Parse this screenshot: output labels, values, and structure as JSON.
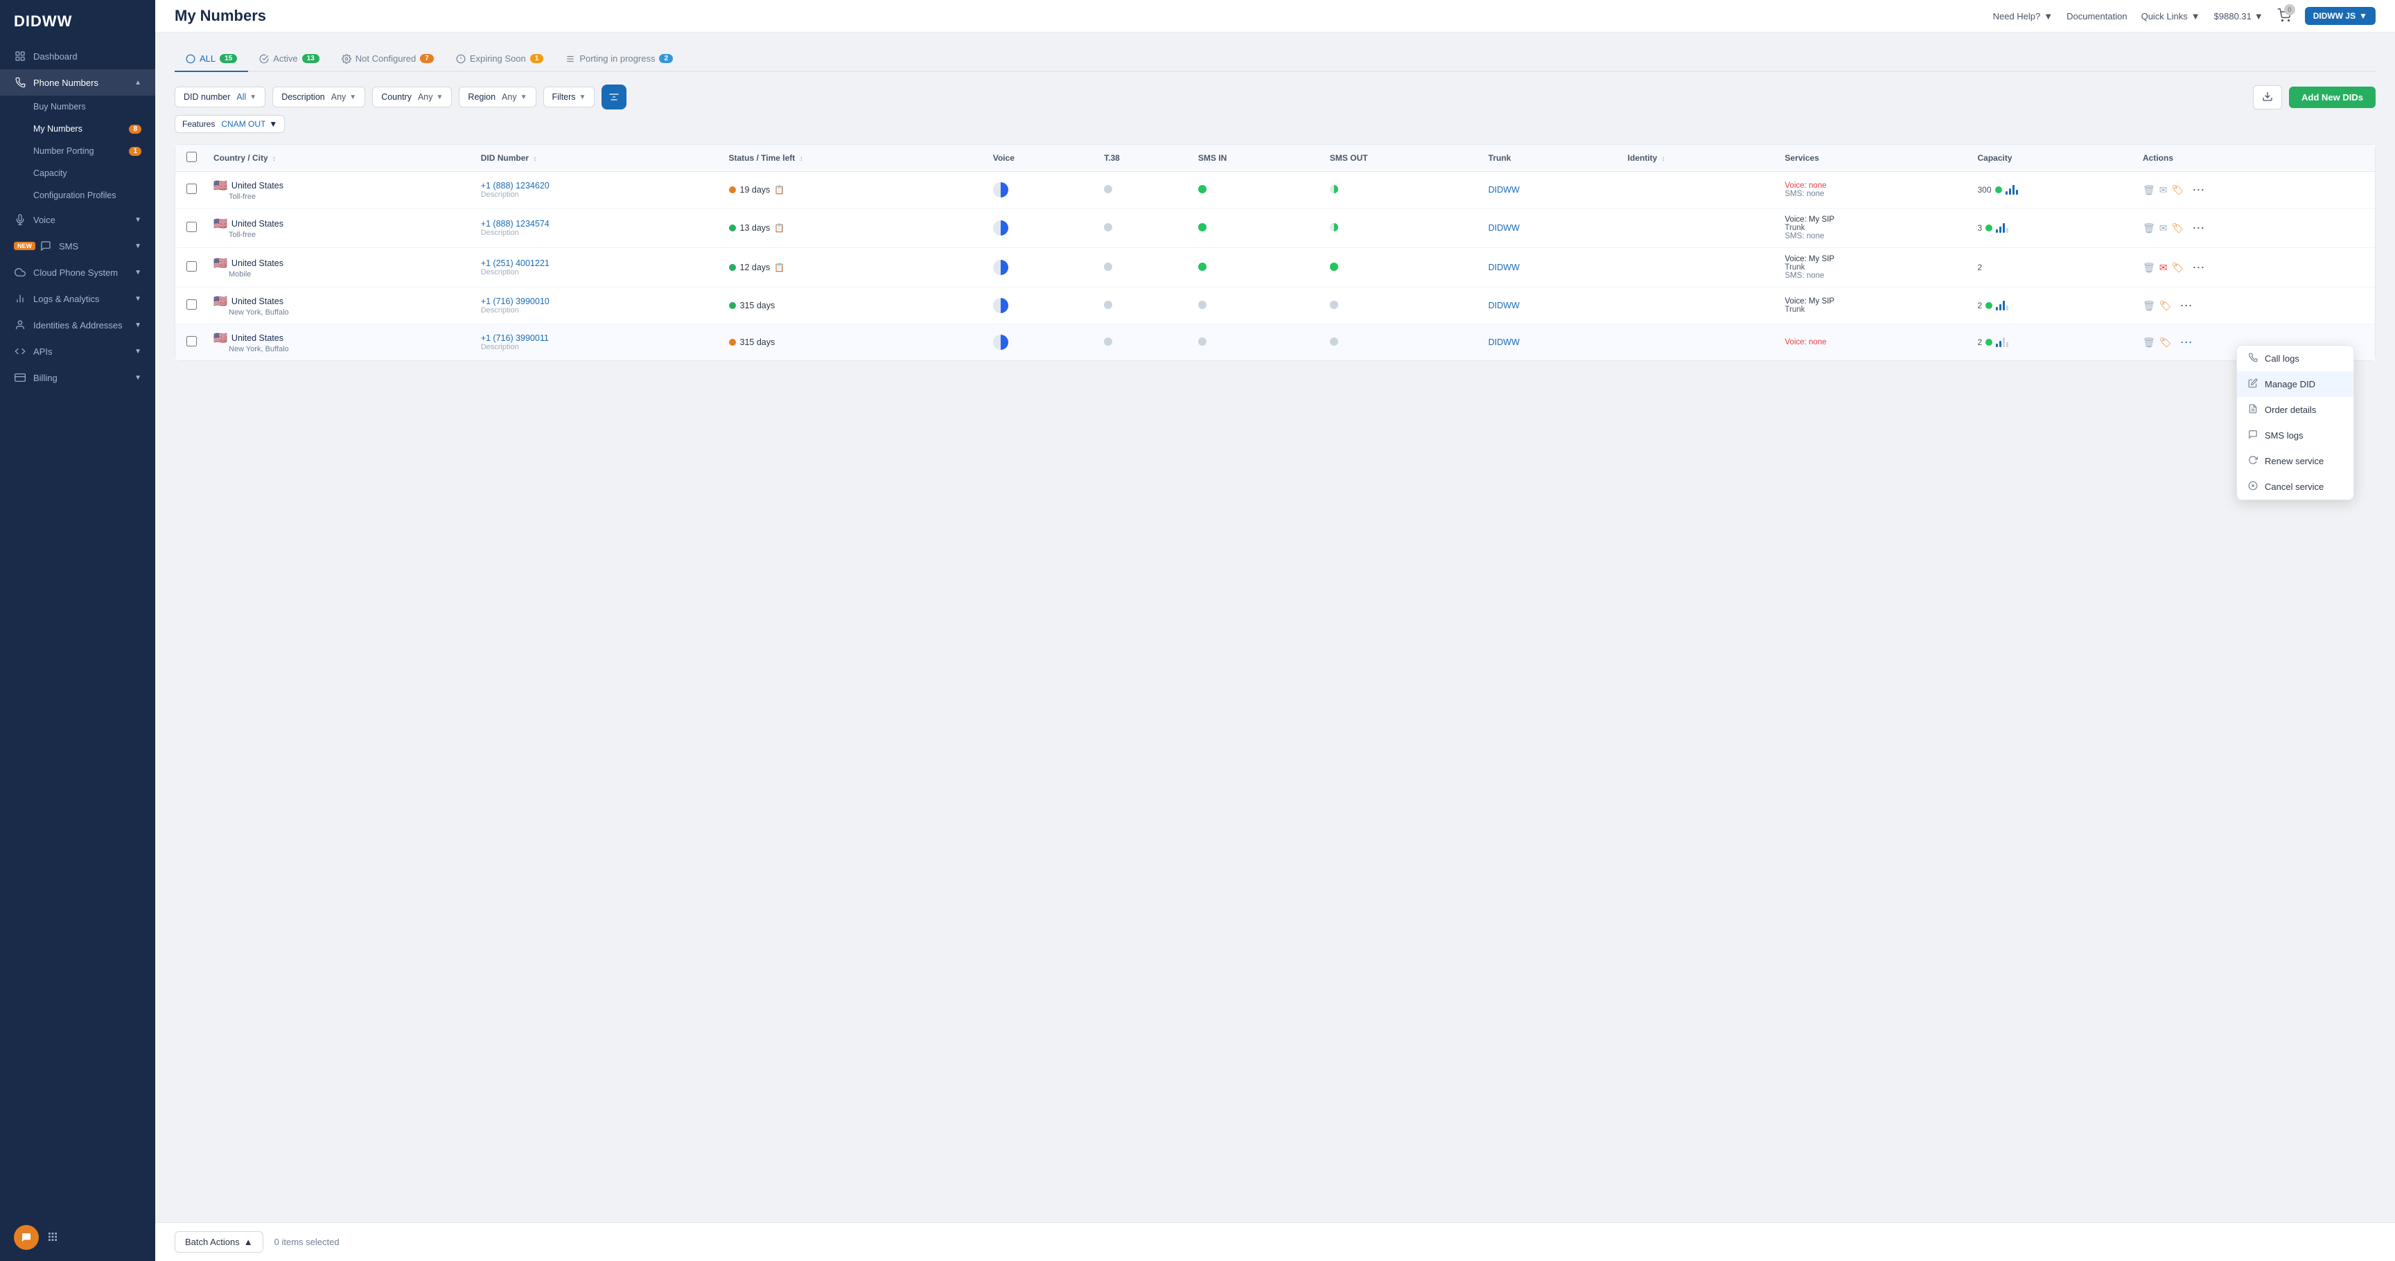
{
  "sidebar": {
    "logo": "DIDWW",
    "nav": [
      {
        "id": "dashboard",
        "label": "Dashboard",
        "icon": "grid",
        "active": false,
        "badge": null
      },
      {
        "id": "phone-numbers",
        "label": "Phone Numbers",
        "icon": "phone",
        "active": true,
        "expanded": true,
        "badge": null
      },
      {
        "id": "buy-numbers",
        "label": "Buy Numbers",
        "sub": true,
        "active": false,
        "badge": null
      },
      {
        "id": "my-numbers",
        "label": "My Numbers",
        "sub": true,
        "active": true,
        "badge": "8"
      },
      {
        "id": "number-porting",
        "label": "Number Porting",
        "sub": true,
        "active": false,
        "badge": "1"
      },
      {
        "id": "capacity",
        "label": "Capacity",
        "sub": true,
        "active": false,
        "badge": null
      },
      {
        "id": "configuration-profiles",
        "label": "Configuration Profiles",
        "sub": true,
        "active": false,
        "badge": null
      },
      {
        "id": "voice",
        "label": "Voice",
        "icon": "mic",
        "active": false,
        "badge": null
      },
      {
        "id": "sms",
        "label": "SMS",
        "icon": "message",
        "active": false,
        "badge": null,
        "new": true
      },
      {
        "id": "cloud-phone",
        "label": "Cloud Phone System",
        "icon": "cloud",
        "active": false,
        "badge": null
      },
      {
        "id": "logs",
        "label": "Logs & Analytics",
        "icon": "bar-chart",
        "active": false,
        "badge": null
      },
      {
        "id": "identities",
        "label": "Identities & Addresses",
        "icon": "user",
        "active": false,
        "badge": null
      },
      {
        "id": "apis",
        "label": "APIs",
        "icon": "code",
        "active": false,
        "badge": null
      },
      {
        "id": "billing",
        "label": "Billing",
        "icon": "credit-card",
        "active": false,
        "badge": null
      }
    ]
  },
  "header": {
    "title": "My Numbers",
    "needHelp": "Need Help?",
    "documentation": "Documentation",
    "quickLinks": "Quick Links",
    "balance": "$9880.31",
    "cartCount": "0",
    "userLabel": "DIDWW JS"
  },
  "tabs": [
    {
      "id": "all",
      "label": "ALL",
      "count": "15",
      "badge_class": "green",
      "active": true
    },
    {
      "id": "active",
      "label": "Active",
      "count": "13",
      "badge_class": "green",
      "active": false
    },
    {
      "id": "not-configured",
      "label": "Not Configured",
      "count": "7",
      "badge_class": "orange",
      "active": false
    },
    {
      "id": "expiring-soon",
      "label": "Expiring Soon",
      "count": "1",
      "badge_class": "yellow",
      "active": false
    },
    {
      "id": "porting",
      "label": "Porting in progress",
      "count": "2",
      "badge_class": "blue",
      "active": false
    }
  ],
  "filters": {
    "did_number": {
      "label": "DID number",
      "value": "All"
    },
    "description": {
      "label": "Description",
      "value": "Any"
    },
    "country": {
      "label": "Country",
      "value": "Any"
    },
    "region": {
      "label": "Region",
      "value": "Any"
    },
    "filters_btn": "Filters",
    "features_label": "Features",
    "features_value": "CNAM OUT"
  },
  "table": {
    "columns": [
      "",
      "Country / City",
      "DID Number",
      "Status / Time left",
      "Voice",
      "T.38",
      "SMS IN",
      "SMS OUT",
      "Trunk",
      "Identity",
      "Services",
      "Capacity",
      "Actions"
    ],
    "rows": [
      {
        "id": "row1",
        "country": "United States",
        "city": "Toll-free",
        "flag": "🇺🇸",
        "did": "+1 (888) 1234620",
        "desc": "Description",
        "status_color": "orange",
        "status_time": "19 days",
        "voice": "half",
        "t38": "gray",
        "sms_in": "green",
        "sms_out": "half",
        "trunk": "DIDWW",
        "identity": "",
        "service_voice": "Voice: none",
        "service_voice_class": "red",
        "service_sms": "SMS: none",
        "capacity": "300",
        "has_actions": true,
        "context_menu_open": false
      },
      {
        "id": "row2",
        "country": "United States",
        "city": "Toll-free",
        "flag": "🇺🇸",
        "did": "+1 (888) 1234574",
        "desc": "Description",
        "status_color": "green",
        "status_time": "13 days",
        "voice": "half",
        "t38": "gray",
        "sms_in": "green",
        "sms_out": "half",
        "trunk": "DIDWW",
        "identity": "",
        "service_voice": "Voice: My SIP",
        "service_voice_class": "normal",
        "service_trunk": "Trunk",
        "service_sms": "SMS: none",
        "capacity": "3",
        "has_actions": true,
        "context_menu_open": false
      },
      {
        "id": "row3",
        "country": "United States",
        "city": "Mobile",
        "flag": "🇺🇸",
        "did": "+1 (251) 4001221",
        "desc": "Description",
        "status_color": "green",
        "status_time": "12 days",
        "voice": "half",
        "t38": "gray",
        "sms_in": "green",
        "sms_out": "green",
        "trunk": "DIDWW",
        "identity": "",
        "service_voice": "Voice: My SIP",
        "service_voice_class": "normal",
        "service_trunk": "Trunk",
        "service_sms": "SMS: none",
        "capacity": "2",
        "has_actions": true,
        "context_menu_open": false,
        "has_alert": true
      },
      {
        "id": "row4",
        "country": "United States",
        "city": "New York, Buffalo",
        "flag": "🇺🇸",
        "did": "+1 (716) 3990010",
        "desc": "Description",
        "status_color": "green",
        "status_time": "315 days",
        "voice": "half",
        "t38": "gray",
        "sms_in": "gray",
        "sms_out": "gray",
        "trunk": "DIDWW",
        "identity": "",
        "service_voice": "Voice: My SIP",
        "service_voice_class": "normal",
        "service_trunk": "Trunk",
        "service_sms": "",
        "capacity": "2",
        "has_actions": true,
        "context_menu_open": false
      },
      {
        "id": "row5",
        "country": "United States",
        "city": "New York, Buffalo",
        "flag": "🇺🇸",
        "did": "+1 (716) 3990011",
        "desc": "Description",
        "status_color": "orange",
        "status_time": "315 days",
        "voice": "half",
        "t38": "gray",
        "sms_in": "gray",
        "sms_out": "gray",
        "trunk": "DIDWW",
        "identity": "",
        "service_voice": "Voice: none",
        "service_voice_class": "red",
        "service_sms": "",
        "capacity": "2",
        "has_actions": true,
        "context_menu_open": true
      }
    ]
  },
  "context_menu": {
    "items": [
      {
        "id": "call-logs",
        "label": "Call logs",
        "icon": "phone-logs"
      },
      {
        "id": "manage-did",
        "label": "Manage DID",
        "icon": "edit",
        "active": true
      },
      {
        "id": "order-details",
        "label": "Order details",
        "icon": "receipt"
      },
      {
        "id": "sms-logs",
        "label": "SMS logs",
        "icon": "sms"
      },
      {
        "id": "renew-service",
        "label": "Renew service",
        "icon": "refresh"
      },
      {
        "id": "cancel-service",
        "label": "Cancel service",
        "icon": "cancel"
      }
    ]
  },
  "bottom_bar": {
    "batch_actions": "Batch Actions",
    "items_selected": "0 items selected"
  },
  "add_dids_btn": "Add New DIDs"
}
